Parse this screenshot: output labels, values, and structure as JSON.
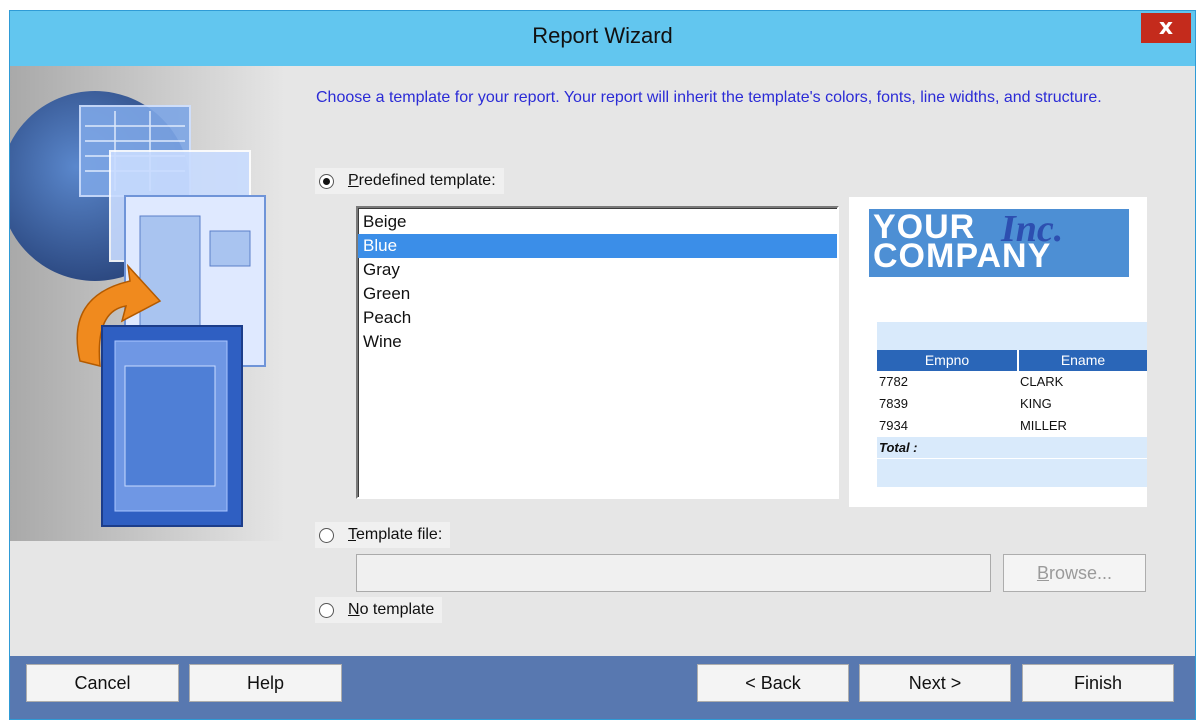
{
  "window": {
    "title": "Report Wizard",
    "close_label": "x"
  },
  "intro_text": "Choose a template for your report. Your report will inherit the template's colors, fonts, line widths, and structure.",
  "options": {
    "predefined": {
      "mnemonic": "P",
      "rest": "redefined template:",
      "checked": true
    },
    "template_file": {
      "mnemonic": "T",
      "rest": "emplate file:",
      "checked": false
    },
    "no_template": {
      "mnemonic": "N",
      "rest": "o template",
      "checked": false
    }
  },
  "templates": [
    "Beige",
    "Blue",
    "Gray",
    "Green",
    "Peach",
    "Wine"
  ],
  "selected_template": "Blue",
  "template_file_value": "",
  "browse_label": {
    "mnemonic": "B",
    "rest": "rowse..."
  },
  "preview": {
    "logo_line1": "YOUR",
    "logo_inc": "Inc.",
    "logo_line2": "COMPANY",
    "columns": [
      "Empno",
      "Ename"
    ],
    "rows": [
      [
        "7782",
        "CLARK"
      ],
      [
        "7839",
        "KING"
      ],
      [
        "7934",
        "MILLER"
      ]
    ],
    "total_label": "Total :",
    "colors": {
      "header": "#2a66b8",
      "band": "#d9eafb",
      "logo": "#4d8fd4"
    }
  },
  "buttons": {
    "cancel": "Cancel",
    "help": "Help",
    "back": "< Back",
    "next": "Next >",
    "finish": "Finish"
  },
  "icons": [
    "report-wizard-graphic",
    "close-icon"
  ]
}
